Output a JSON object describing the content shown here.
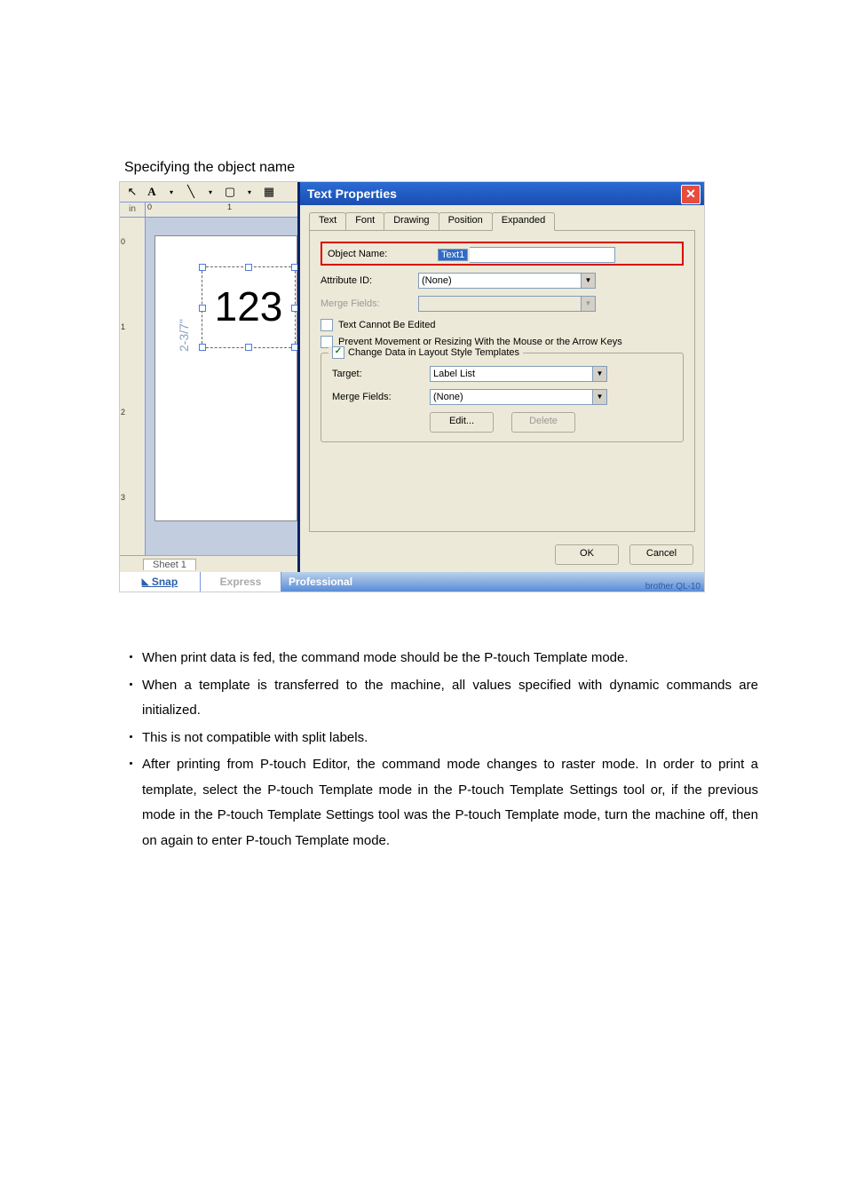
{
  "heading": "Specifying the object name",
  "editor": {
    "unit": "in",
    "ruler_marks": [
      "0",
      "1",
      "2",
      "3"
    ],
    "object_text": "123",
    "dimension": "2-3/7\"",
    "sheet_tab": "Sheet 1",
    "modes": {
      "snap": "Snap",
      "express": "Express",
      "professional": "Professional",
      "brand_tail": "brother QL-10"
    }
  },
  "dialog": {
    "title": "Text Properties",
    "tabs": [
      "Text",
      "Font",
      "Drawing",
      "Position",
      "Expanded"
    ],
    "active_tab_index": 4,
    "object_name_label": "Object Name:",
    "object_name_value": "Text1",
    "attribute_id_label": "Attribute ID:",
    "attribute_id_value": "(None)",
    "merge_fields_label": "Merge Fields:",
    "merge_fields_value": "",
    "chk_cannot_edit": "Text Cannot Be Edited",
    "chk_prevent": "Prevent Movement or Resizing With the Mouse or the Arrow Keys",
    "group_legend": "Change Data in Layout Style Templates",
    "target_label": "Target:",
    "target_value": "Label List",
    "merge_fields2_label": "Merge Fields:",
    "merge_fields2_value": "(None)",
    "edit_btn": "Edit...",
    "delete_btn": "Delete",
    "ok_btn": "OK",
    "cancel_btn": "Cancel"
  },
  "notes": [
    "When print data is fed, the command mode should be the P-touch Template mode.",
    "When a template is transferred to the machine, all values specified with dynamic commands are initialized.",
    "This is not compatible with split labels.",
    "After printing from P-touch Editor, the command mode changes to raster mode. In order to print a template, select the P-touch Template mode in the P-touch Template Settings tool or, if the previous mode in the P-touch Template Settings tool was the P-touch Template mode, turn the machine off, then on again to enter P-touch Template mode."
  ],
  "bullet": "・"
}
